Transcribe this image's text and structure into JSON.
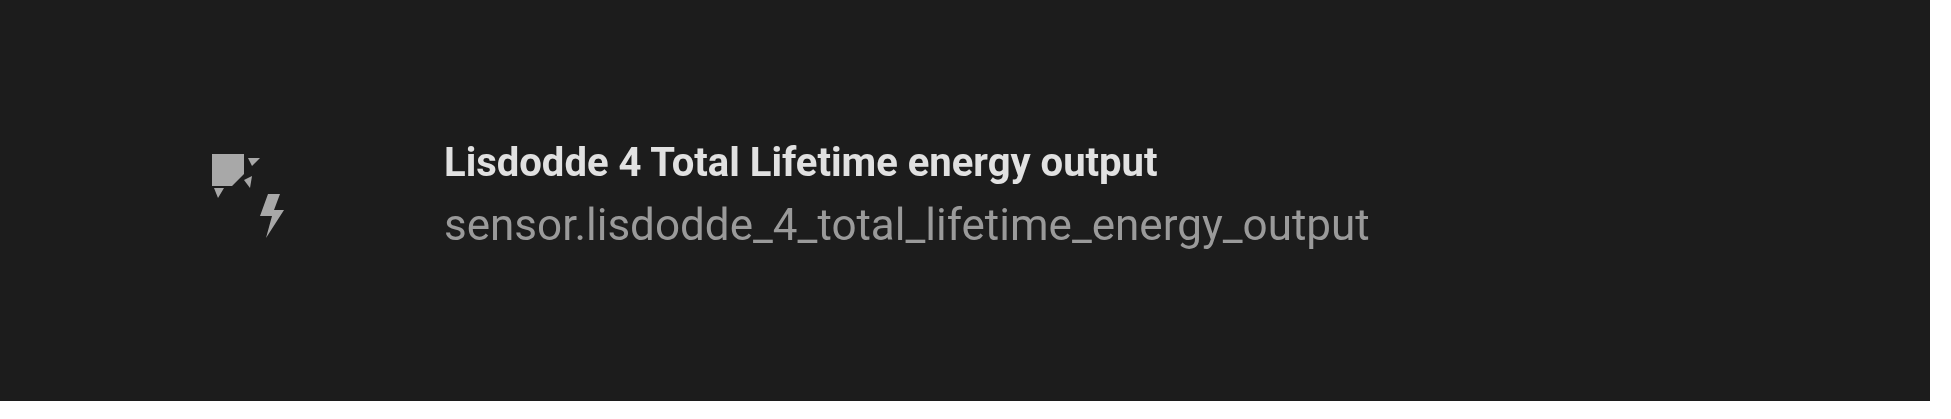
{
  "entity": {
    "name": "Lisdodde 4 Total Lifetime energy output",
    "entity_id": "sensor.lisdodde_4_total_lifetime_energy_output"
  }
}
